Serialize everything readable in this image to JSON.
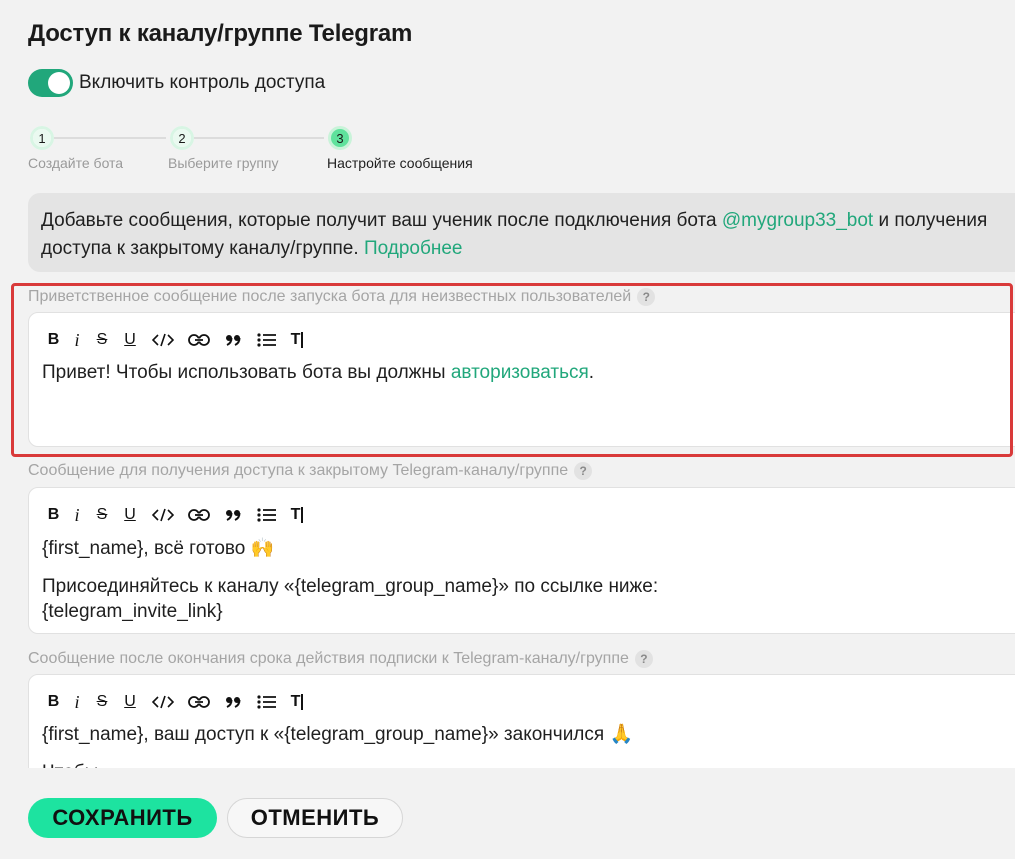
{
  "page": {
    "title": "Доступ к каналу/группе Telegram"
  },
  "toggle": {
    "label": "Включить контроль доступа",
    "on": true
  },
  "steps": [
    {
      "number": "1",
      "label": "Создайте бота"
    },
    {
      "number": "2",
      "label": "Выберите группу"
    },
    {
      "number": "3",
      "label": "Настройте сообщения"
    }
  ],
  "info": {
    "text_before": "Добавьте сообщения, которые получит ваш ученик после подключения бота ",
    "bot_name": "@mygroup33_bot",
    "text_after_bot": " и получения",
    "line2": "доступа к закрытому каналу/группе. ",
    "more_link": "Подробнее"
  },
  "toolbar": {
    "bold": "B",
    "italic": "i",
    "strike": "S",
    "underline": "U",
    "clear": "T"
  },
  "sections": [
    {
      "label": "Приветственное сообщение после запуска бота для неизвестных пользователей",
      "help": "?",
      "text_before": "Привет! Чтобы использовать бота вы должны ",
      "link": "авторизоваться",
      "text_after": "."
    },
    {
      "label": "Сообщение для получения доступа к закрытому Telegram-каналу/группе",
      "help": "?",
      "line1": "{first_name}, всё готово 🙌",
      "line2": "Присоединяйтесь к каналу «{telegram_group_name}» по ссылке ниже:",
      "line3": "{telegram_invite_link}"
    },
    {
      "label": "Сообщение после окончания срока действия подписки к Telegram-каналу/группе",
      "help": "?",
      "line1": "{first_name}, ваш доступ к «{telegram_group_name}» закончился 🙏",
      "line2": "Чтобы"
    }
  ],
  "buttons": {
    "save": "СОХРАНИТЬ",
    "cancel": "ОТМЕНИТЬ"
  },
  "colors": {
    "accent": "#21a77b",
    "save_button": "#1de3a0",
    "highlight": "#d93a3a"
  }
}
